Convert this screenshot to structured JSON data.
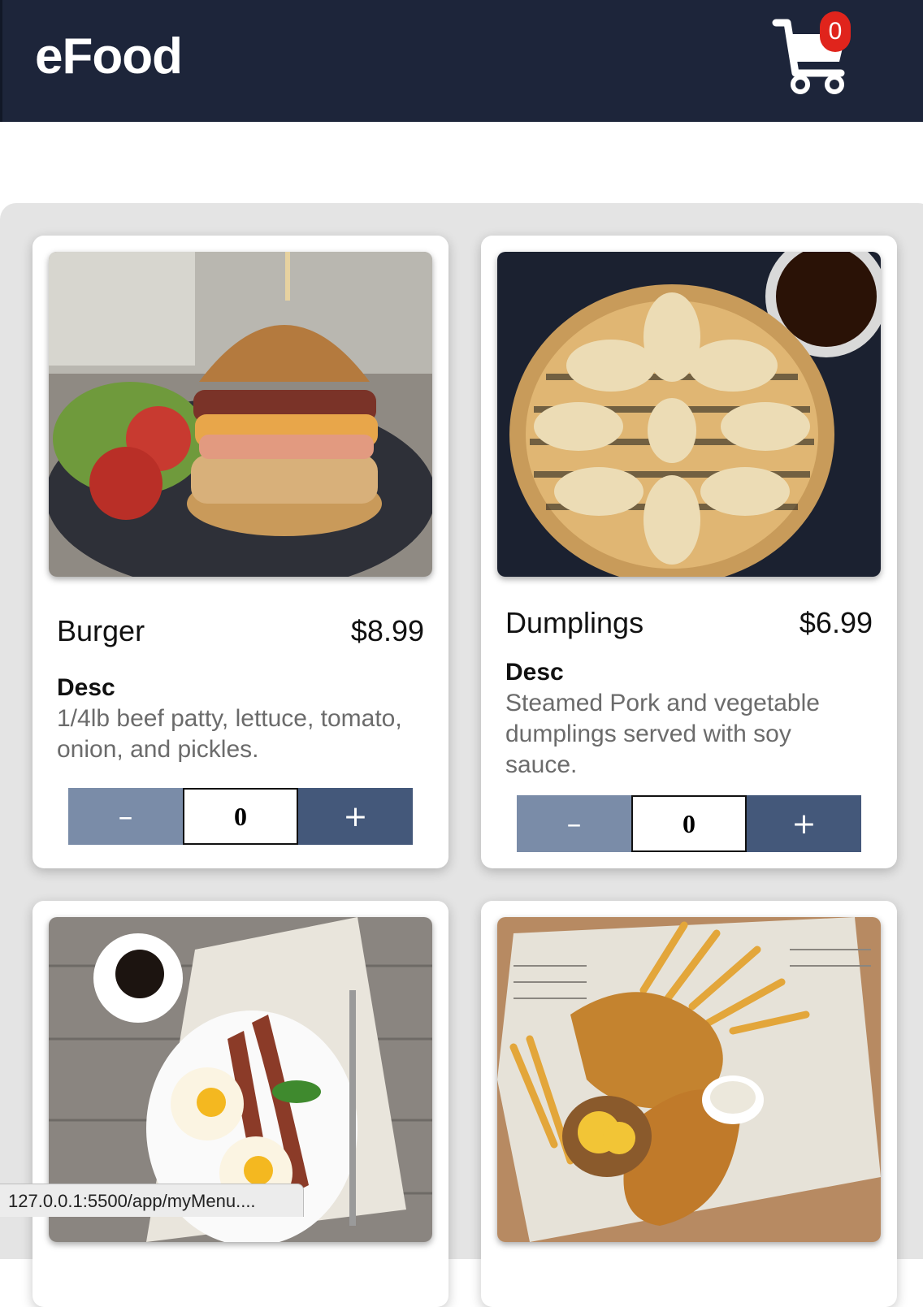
{
  "navbar": {
    "brand": "eFood",
    "cart_icon": "cart-icon",
    "cart_count": "0",
    "colors": {
      "background": "#1d253a",
      "badge": "#e0241c"
    }
  },
  "menu": {
    "items": [
      {
        "name": "Burger",
        "price": "$8.99",
        "desc_label": "Desc",
        "desc": "1/4lb beef patty, lettuce, tomato, onion, and pickles.",
        "quantity": "0",
        "minus_label": "–",
        "plus_label": "+"
      },
      {
        "name": "Dumplings",
        "price": "$6.99",
        "desc_label": "Desc",
        "desc": "Steamed Pork and vegetable dumplings served with soy sauce.",
        "quantity": "0",
        "minus_label": "–",
        "plus_label": "+"
      },
      {
        "image": "breakfast-photo"
      },
      {
        "image": "fish-and-chips-photo"
      }
    ],
    "colors": {
      "minus": "#7a8ca8",
      "plus": "#44587a"
    }
  },
  "status_bar": {
    "url": "127.0.0.1:5500/app/myMenu...."
  }
}
